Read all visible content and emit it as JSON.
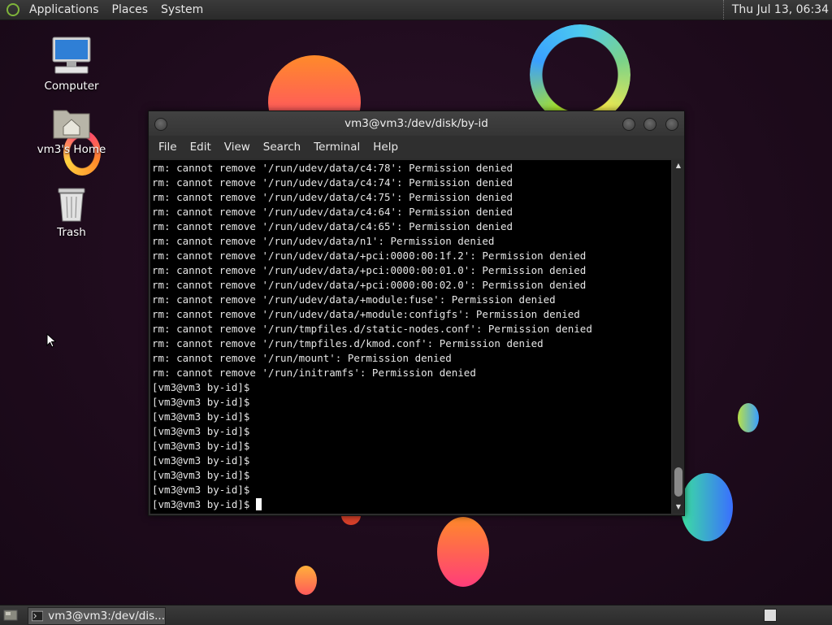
{
  "top_panel": {
    "menus": [
      "Applications",
      "Places",
      "System"
    ],
    "clock": "Thu Jul 13, 06:34"
  },
  "desktop_icons": [
    {
      "label": "Computer",
      "icon": "computer-icon"
    },
    {
      "label": "vm3's Home",
      "icon": "home-folder-icon"
    },
    {
      "label": "Trash",
      "icon": "trash-icon"
    }
  ],
  "terminal": {
    "title": "vm3@vm3:/dev/disk/by-id",
    "menu": [
      "File",
      "Edit",
      "View",
      "Search",
      "Terminal",
      "Help"
    ],
    "lines": [
      "rm: cannot remove '/run/udev/data/c4:78': Permission denied",
      "rm: cannot remove '/run/udev/data/c4:74': Permission denied",
      "rm: cannot remove '/run/udev/data/c4:75': Permission denied",
      "rm: cannot remove '/run/udev/data/c4:64': Permission denied",
      "rm: cannot remove '/run/udev/data/c4:65': Permission denied",
      "rm: cannot remove '/run/udev/data/n1': Permission denied",
      "rm: cannot remove '/run/udev/data/+pci:0000:00:1f.2': Permission denied",
      "rm: cannot remove '/run/udev/data/+pci:0000:00:01.0': Permission denied",
      "rm: cannot remove '/run/udev/data/+pci:0000:00:02.0': Permission denied",
      "rm: cannot remove '/run/udev/data/+module:fuse': Permission denied",
      "rm: cannot remove '/run/udev/data/+module:configfs': Permission denied",
      "rm: cannot remove '/run/tmpfiles.d/static-nodes.conf': Permission denied",
      "rm: cannot remove '/run/tmpfiles.d/kmod.conf': Permission denied",
      "rm: cannot remove '/run/mount': Permission denied",
      "rm: cannot remove '/run/initramfs': Permission denied",
      "[vm3@vm3 by-id]$",
      "[vm3@vm3 by-id]$",
      "[vm3@vm3 by-id]$",
      "[vm3@vm3 by-id]$",
      "[vm3@vm3 by-id]$",
      "[vm3@vm3 by-id]$",
      "[vm3@vm3 by-id]$",
      "[vm3@vm3 by-id]$"
    ],
    "prompt": "[vm3@vm3 by-id]$ "
  },
  "taskbar": {
    "window_label": "vm3@vm3:/dev/dis..."
  },
  "colors": {
    "desktop_bg": "#200d1f",
    "terminal_bg": "#000000",
    "terminal_fg": "#e6e6e6"
  }
}
